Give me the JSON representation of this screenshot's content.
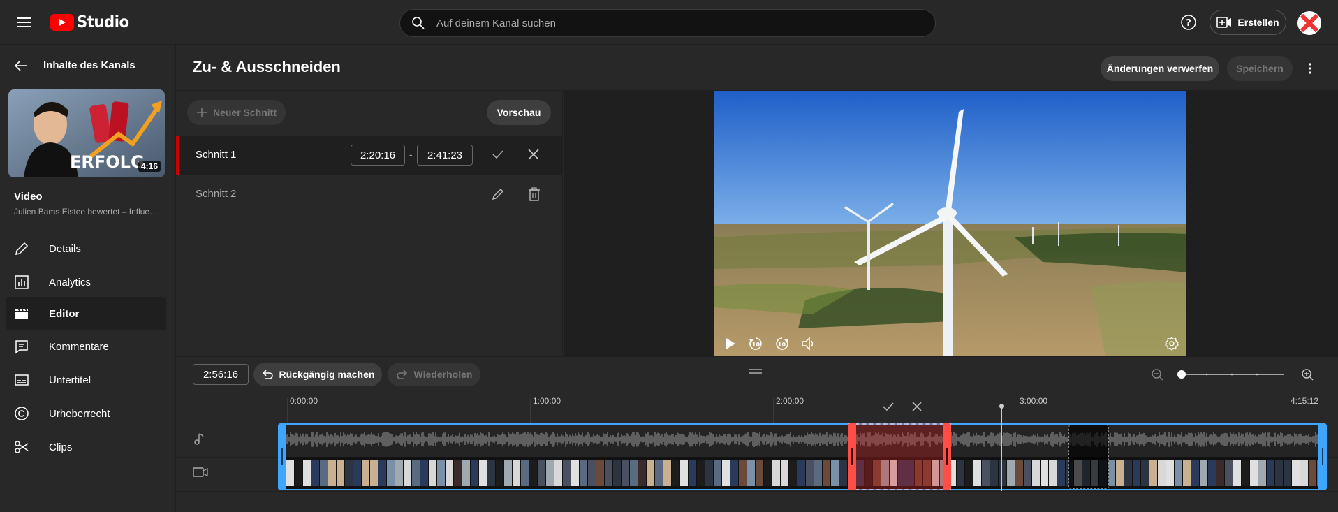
{
  "app": {
    "brand": "Studio"
  },
  "search": {
    "placeholder": "Auf deinem Kanal suchen"
  },
  "header": {
    "create_label": "Erstellen"
  },
  "sidebar": {
    "back_label": "Inhalte des Kanals",
    "thumb_duration": "4:16",
    "thumb_text": "ERFOLG",
    "video_label": "Video",
    "video_title": "Julien Bams Eistee bewertet – Influencer",
    "items": [
      {
        "label": "Details",
        "icon": "pencil-icon"
      },
      {
        "label": "Analytics",
        "icon": "analytics-icon"
      },
      {
        "label": "Editor",
        "icon": "clapper-icon"
      },
      {
        "label": "Kommentare",
        "icon": "comment-icon"
      },
      {
        "label": "Untertitel",
        "icon": "subtitles-icon"
      },
      {
        "label": "Urheberrecht",
        "icon": "copyright-icon"
      },
      {
        "label": "Clips",
        "icon": "scissors-icon"
      }
    ]
  },
  "page": {
    "title": "Zu- & Ausschneiden",
    "discard_label": "Änderungen verwerfen",
    "save_label": "Speichern"
  },
  "cuts": {
    "new_cut_label": "Neuer Schnitt",
    "preview_label": "Vorschau",
    "list": [
      {
        "label": "Schnitt 1",
        "start": "2:20:16",
        "end": "2:41:23",
        "dash": "-"
      },
      {
        "label": "Schnitt 2"
      }
    ]
  },
  "timeline": {
    "duration": "2:56:16",
    "undo_label": "Rückgängig machen",
    "redo_label": "Wiederholen",
    "zoom_level": 0.0,
    "ticks": [
      "0:00:00",
      "1:00:00",
      "2:00:00",
      "3:00:00",
      "4:15:12"
    ]
  },
  "colors": {
    "accent": "#3ea6ff",
    "cut": "#ff4e45",
    "brand": "#ff0000"
  }
}
